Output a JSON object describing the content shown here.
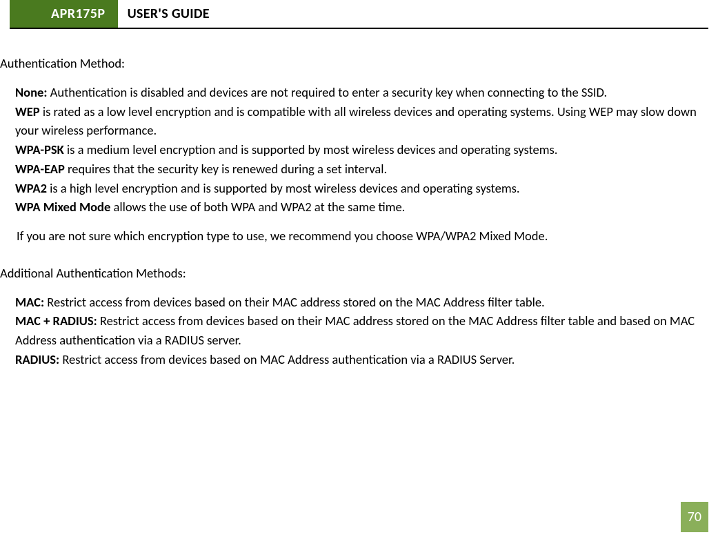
{
  "header": {
    "model": "APR175P",
    "title": "USER'S GUIDE"
  },
  "section1": {
    "heading": "Authentication Method:",
    "items": [
      {
        "label": "None:",
        "text": " Authentication is disabled and devices are not required to enter a security key when connecting to the SSID."
      },
      {
        "label": "WEP",
        "text": " is rated as a low level encryption and is compatible with all wireless devices and operating systems. Using WEP may slow down your wireless performance."
      },
      {
        "label": "WPA-PSK",
        "text": " is a medium level encryption and is supported by most wireless devices and operating systems."
      },
      {
        "label": "WPA-EAP",
        "text": " requires that the security key is renewed during a set interval."
      },
      {
        "label": "WPA2",
        "text": " is a high level encryption and is supported by most wireless devices and operating systems."
      },
      {
        "label": "WPA Mixed Mode",
        "text": " allows the use of both WPA and WPA2 at the same time."
      }
    ],
    "recommendation": "If you are not sure which encryption type to use, we recommend you choose WPA/WPA2 Mixed Mode."
  },
  "section2": {
    "heading": "Additional Authentication Methods:",
    "items": [
      {
        "label": "MAC:",
        "text": " Restrict access from devices based on their MAC address stored on the MAC Address filter table."
      },
      {
        "label": "MAC + RADIUS:",
        "text": " Restrict access from devices based on their MAC address stored on the MAC Address filter table and based on MAC Address authentication via a RADIUS server."
      },
      {
        "label": "RADIUS:",
        "text": " Restrict access from devices based on MAC Address authentication via a RADIUS Server."
      }
    ]
  },
  "pageNumber": "70"
}
